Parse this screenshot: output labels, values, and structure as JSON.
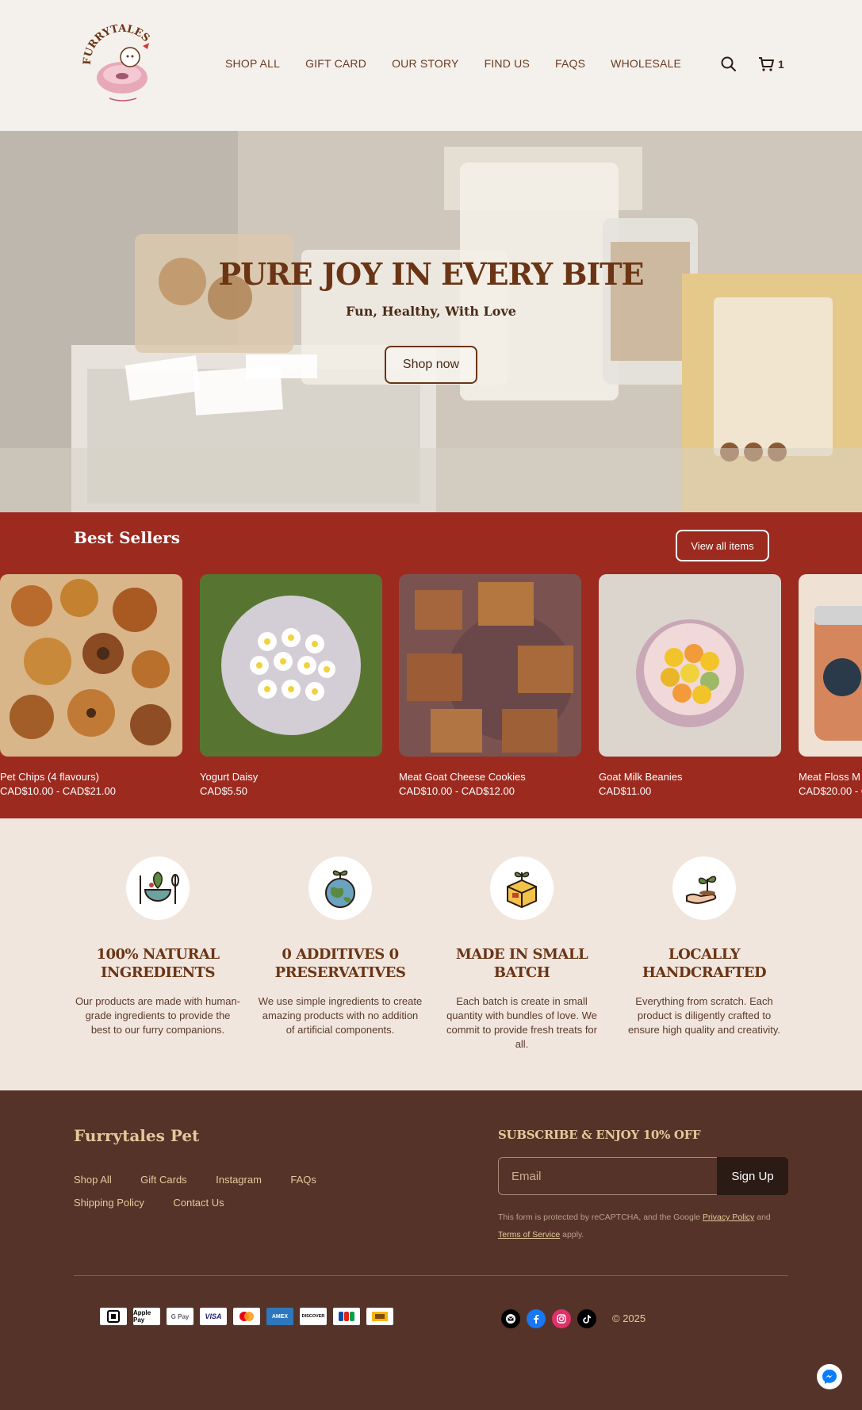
{
  "header": {
    "nav": [
      "SHOP ALL",
      "GIFT CARD",
      "OUR STORY",
      "FIND US",
      "FAQS",
      "WHOLESALE"
    ],
    "cart_count": "1",
    "logo_text": "FURRYTALES"
  },
  "hero": {
    "title": "PURE JOY IN EVERY BITE",
    "subtitle": "Fun, Healthy, With Love",
    "button": "Shop now"
  },
  "best_sellers": {
    "title": "Best Sellers",
    "view_all": "View all items",
    "products": [
      {
        "name": "Pet Chips (4 flavours)",
        "price": "CAD$10.00 - CAD$21.00"
      },
      {
        "name": "Yogurt Daisy",
        "price": "CAD$5.50"
      },
      {
        "name": "Meat Goat Cheese Cookies",
        "price": "CAD$10.00 - CAD$12.00"
      },
      {
        "name": "Goat Milk Beanies",
        "price": "CAD$11.00"
      },
      {
        "name": "Meat Floss M",
        "price": "CAD$20.00 - C"
      }
    ]
  },
  "features": [
    {
      "icon": "bowl-leaf-icon",
      "title": "100% NATURAL INGREDIENTS",
      "text": "Our products are made with human-grade ingredients to provide the best to our furry companions."
    },
    {
      "icon": "globe-sprout-icon",
      "title": "0 ADDITIVES 0 PRESERVATIVES",
      "text": "We use simple ingredients to create amazing products with no addition of artificial components."
    },
    {
      "icon": "box-sprout-icon",
      "title": "MADE IN SMALL BATCH",
      "text": "Each batch is create in small quantity with bundles of love. We commit to provide fresh treats for all."
    },
    {
      "icon": "hand-sprout-icon",
      "title": "LOCALLY HANDCRAFTED",
      "text": "Everything from scratch. Each product is diligently crafted to ensure high quality and creativity."
    }
  ],
  "footer": {
    "brand": "Furrytales Pet",
    "links": [
      "Shop All",
      "Gift Cards",
      "Instagram",
      "FAQs",
      "Shipping Policy",
      "Contact Us"
    ],
    "subscribe_title": "SUBSCRIBE & ENJOY 10% OFF",
    "email_placeholder": "Email",
    "signup": "Sign Up",
    "recaptcha_prefix": "This form is protected by reCAPTCHA, and the Google",
    "privacy_policy": "Privacy Policy",
    "and": "and",
    "terms": "Terms of Service",
    "apply": "apply.",
    "payments": [
      "Square",
      "Apple Pay",
      "G Pay",
      "VISA",
      "Mastercard",
      "AMEX",
      "DISCOVER",
      "JCB",
      "UnionPay"
    ],
    "copyright": "© 2025"
  },
  "colors": {
    "brand_red": "#9c2a1f",
    "brand_brown": "#6b3515",
    "footer_bg": "#563328",
    "cream": "#f1e6dd"
  }
}
